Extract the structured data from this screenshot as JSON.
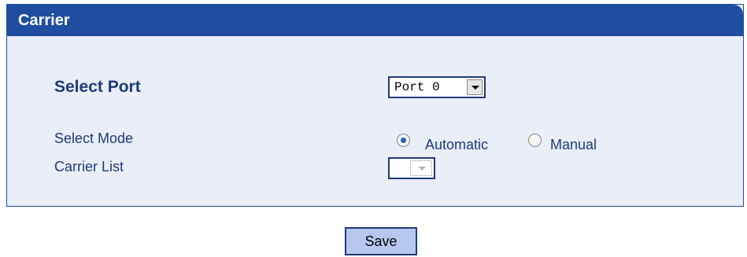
{
  "panel": {
    "title": "Carrier"
  },
  "form": {
    "port": {
      "label": "Select Port",
      "value": "Port 0"
    },
    "mode": {
      "label": "Select Mode",
      "options": [
        {
          "label": "Automatic",
          "checked": true
        },
        {
          "label": "Manual",
          "checked": false
        }
      ]
    },
    "carrier_list": {
      "label": "Carrier List",
      "value": ""
    }
  },
  "actions": {
    "save_label": "Save"
  },
  "icons": {
    "dropdown": "chevron-down-icon",
    "radio": "radio-icon"
  },
  "colors": {
    "header": "#1f4ea1",
    "panel_bg": "#e9eef7",
    "label_text": "#1f3a78",
    "button_bg": "#b7c8f0"
  }
}
